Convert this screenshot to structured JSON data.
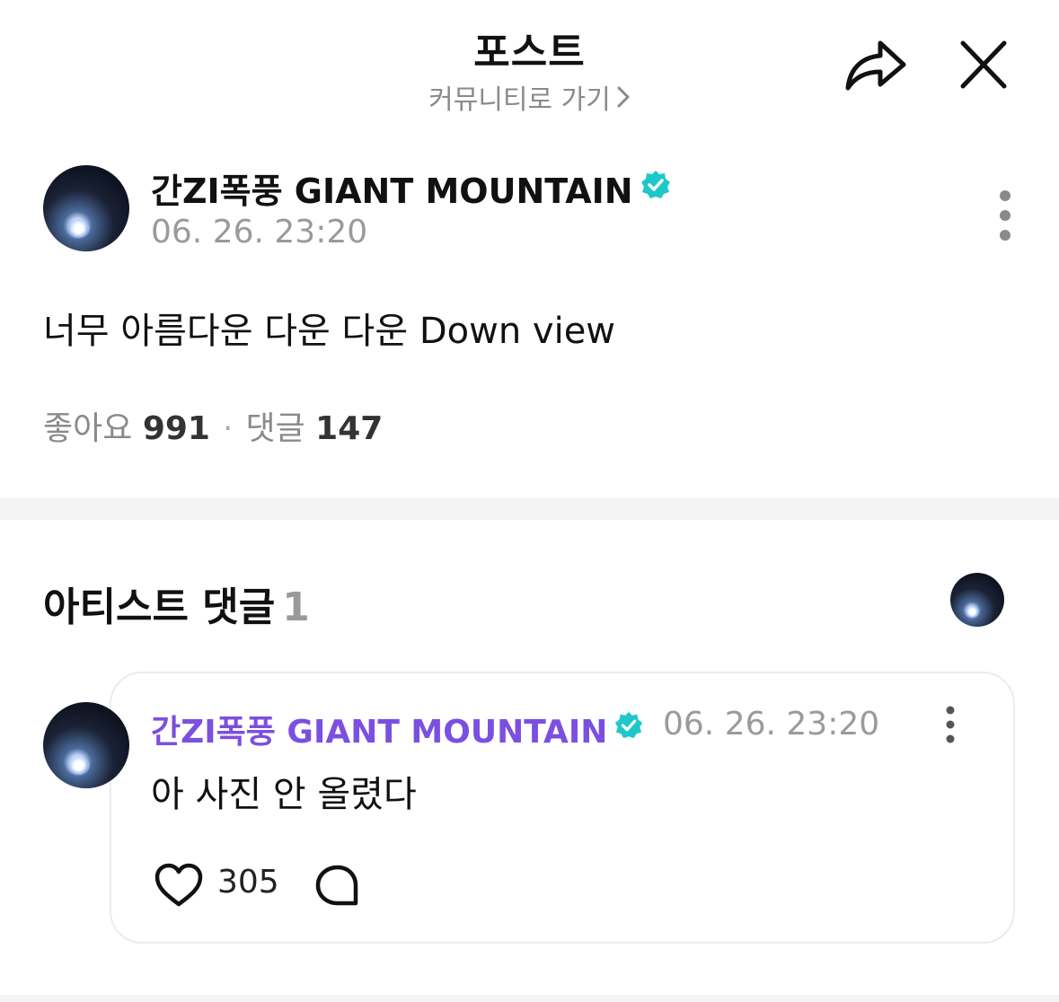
{
  "header": {
    "title": "포스트",
    "community_link": "커뮤니티로 가기",
    "share_icon": "share-arrow-icon",
    "close_icon": "close-icon"
  },
  "post": {
    "author": "간ZI폭풍 GIANT MOUNTAIN",
    "verified_icon": "verified-badge-icon",
    "timestamp": "06. 26. 23:20",
    "body": "너무 아름다운 다운 다운 Down view",
    "likes_label": "좋아요",
    "likes_count": "991",
    "comments_label": "댓글",
    "comments_count": "147"
  },
  "artist_comments": {
    "title": "아티스트 댓글",
    "count": "1"
  },
  "comment": {
    "author": "간ZI폭풍 GIANT MOUNTAIN",
    "timestamp": "06. 26. 23:20",
    "body": "아 사진 안 올렸다",
    "like_count": "305"
  },
  "colors": {
    "accent_purple": "#7b4fe0",
    "verified_teal": "#1ec8c8",
    "muted_text": "#9a9a9a"
  }
}
